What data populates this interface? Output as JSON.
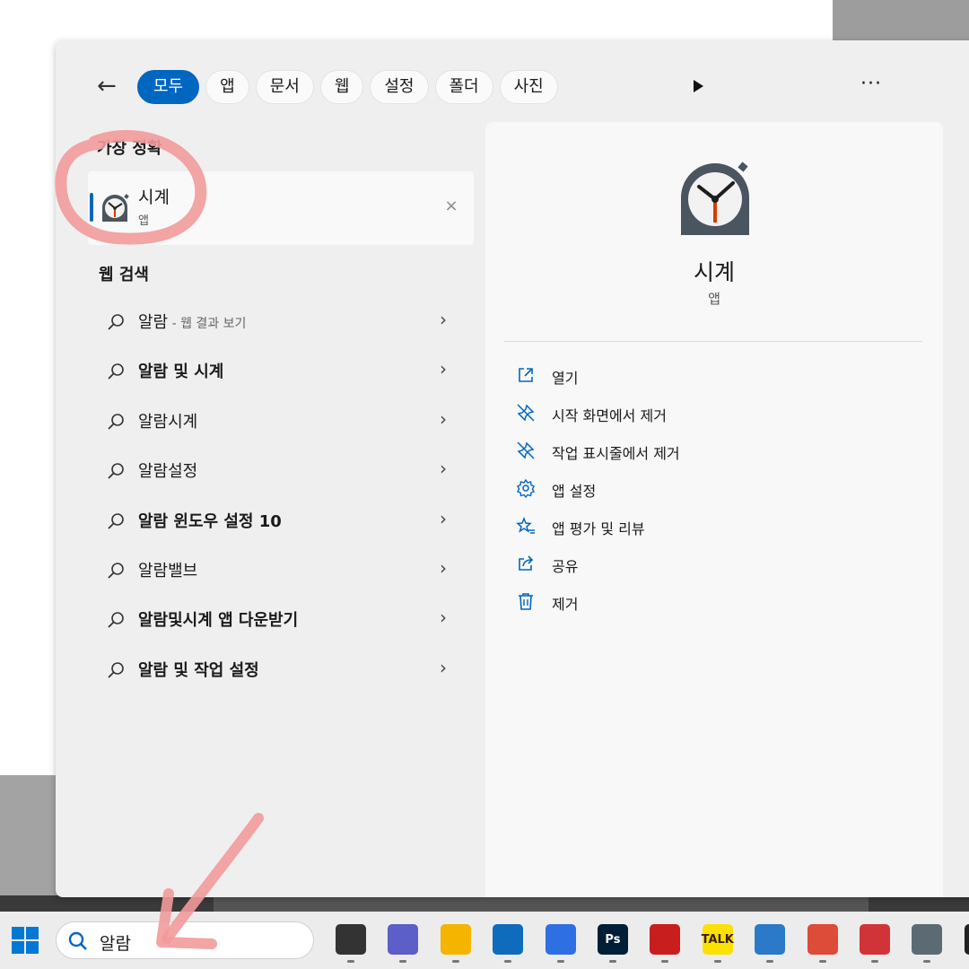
{
  "filters": {
    "back_label": "←",
    "chips": [
      "모두",
      "앱",
      "문서",
      "웹",
      "설정",
      "폴더",
      "사진"
    ],
    "more_label": "···"
  },
  "best_match": {
    "title": "가장 정확",
    "app_name": "시계",
    "app_type": "앱",
    "close_label": "×"
  },
  "web_search": {
    "title": "웹 검색",
    "items": [
      {
        "text": "알람",
        "sub": " - 웹 결과 보기"
      },
      {
        "text": "알람 및 시계",
        "sub": ""
      },
      {
        "text": "알람시계",
        "sub": ""
      },
      {
        "text": "알람설정",
        "sub": ""
      },
      {
        "text": "알람 윈도우 설정 10",
        "sub": ""
      },
      {
        "text": "알람밸브",
        "sub": ""
      },
      {
        "text": "알람및시계 앱 다운받기",
        "sub": ""
      },
      {
        "text": "알람 및 작업 설정",
        "sub": ""
      }
    ],
    "chevron": "›"
  },
  "detail": {
    "app_name": "시계",
    "app_type": "앱",
    "actions": [
      {
        "icon": "open-icon",
        "label": "열기"
      },
      {
        "icon": "unpin-icon",
        "label": "시작 화면에서 제거"
      },
      {
        "icon": "unpin-icon",
        "label": "작업 표시줄에서 제거"
      },
      {
        "icon": "gear-icon",
        "label": "앱 설정"
      },
      {
        "icon": "star-icon",
        "label": "앱 평가 및 리뷰"
      },
      {
        "icon": "share-icon",
        "label": "공유"
      },
      {
        "icon": "trash-icon",
        "label": "제거"
      }
    ]
  },
  "taskbar": {
    "search_query": "알람",
    "apps": [
      {
        "icon": "task-view-icon",
        "color": "#333333",
        "label": ""
      },
      {
        "icon": "teams-chat-icon",
        "color": "#5b5fc7",
        "label": ""
      },
      {
        "icon": "file-explorer-icon",
        "color": "#f4b400",
        "label": ""
      },
      {
        "icon": "mail-icon",
        "color": "#0f6cbd",
        "label": ""
      },
      {
        "icon": "app-hexagon-icon",
        "color": "#2f6fe4",
        "label": ""
      },
      {
        "icon": "photoshop-icon",
        "color": "#001e36",
        "label": "Ps"
      },
      {
        "icon": "red-app-icon",
        "color": "#c81e1e",
        "label": ""
      },
      {
        "icon": "kakaotalk-icon",
        "color": "#fae100",
        "label": "TALK"
      },
      {
        "icon": "notepad-icon",
        "color": "#2a7ac9",
        "label": ""
      },
      {
        "icon": "chrome-icon",
        "color": "#dd4b39",
        "label": ""
      },
      {
        "icon": "snipping-tool-icon",
        "color": "#d13438",
        "label": ""
      },
      {
        "icon": "calculator-icon",
        "color": "#5c6b73",
        "label": ""
      },
      {
        "icon": "terminal-icon",
        "color": "#222222",
        "label": ""
      }
    ]
  },
  "colors": {
    "accent": "#0067c0",
    "annotation": "#f29a9a"
  }
}
